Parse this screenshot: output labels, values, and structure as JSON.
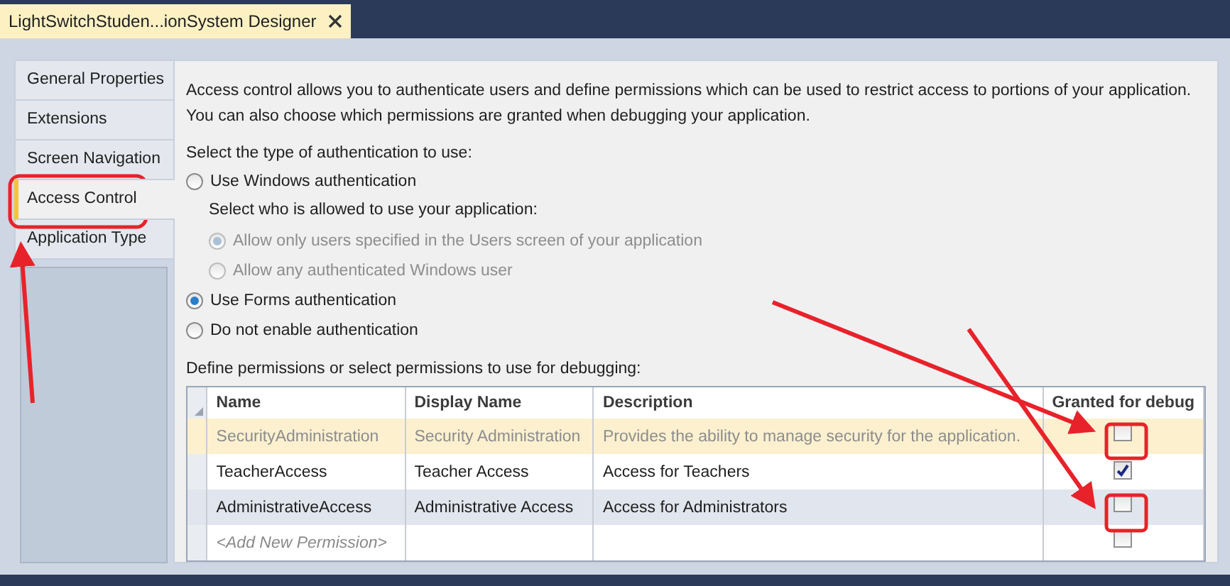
{
  "document_tab": {
    "title": "LightSwitchStuden...ionSystem Designer",
    "selected": true
  },
  "nav_tabs": [
    {
      "label": "General Properties",
      "selected": false
    },
    {
      "label": "Extensions",
      "selected": false
    },
    {
      "label": "Screen Navigation",
      "selected": false
    },
    {
      "label": "Access Control",
      "selected": true
    },
    {
      "label": "Application Type",
      "selected": false
    }
  ],
  "intro": "Access control allows you to authenticate users and define permissions which can be used to restrict access to portions of your application. You can also choose which permissions are granted when debugging your application.",
  "auth_prompt": "Select the type of authentication to use:",
  "auth_options": [
    {
      "label": "Use Windows authentication",
      "selected": false,
      "sub_prompt": "Select who is allowed to use your application:",
      "sub_options": [
        {
          "label": "Allow only users specified in the Users screen of your application",
          "selected": true,
          "disabled": true
        },
        {
          "label": "Allow any authenticated Windows user",
          "selected": false,
          "disabled": true
        }
      ]
    },
    {
      "label": "Use Forms authentication",
      "selected": true
    },
    {
      "label": "Do not enable authentication",
      "selected": false
    }
  ],
  "permissions_prompt": "Define permissions or select permissions to use for debugging:",
  "permissions_table": {
    "columns": [
      "Name",
      "Display Name",
      "Description",
      "Granted for debug"
    ],
    "rows": [
      {
        "name": "SecurityAdministration",
        "display_name": "Security Administration",
        "description": "Provides the ability to manage security for the application.",
        "granted": false,
        "selected": true,
        "disabled": true
      },
      {
        "name": "TeacherAccess",
        "display_name": "Teacher Access",
        "description": "Access for Teachers",
        "granted": true,
        "selected": false,
        "disabled": false
      },
      {
        "name": "AdministrativeAccess",
        "display_name": "Administrative Access",
        "description": "Access for Administrators",
        "granted": false,
        "selected": false,
        "disabled": false
      }
    ],
    "new_row": {
      "placeholder": "<Add New Permission>",
      "granted": false
    }
  }
}
